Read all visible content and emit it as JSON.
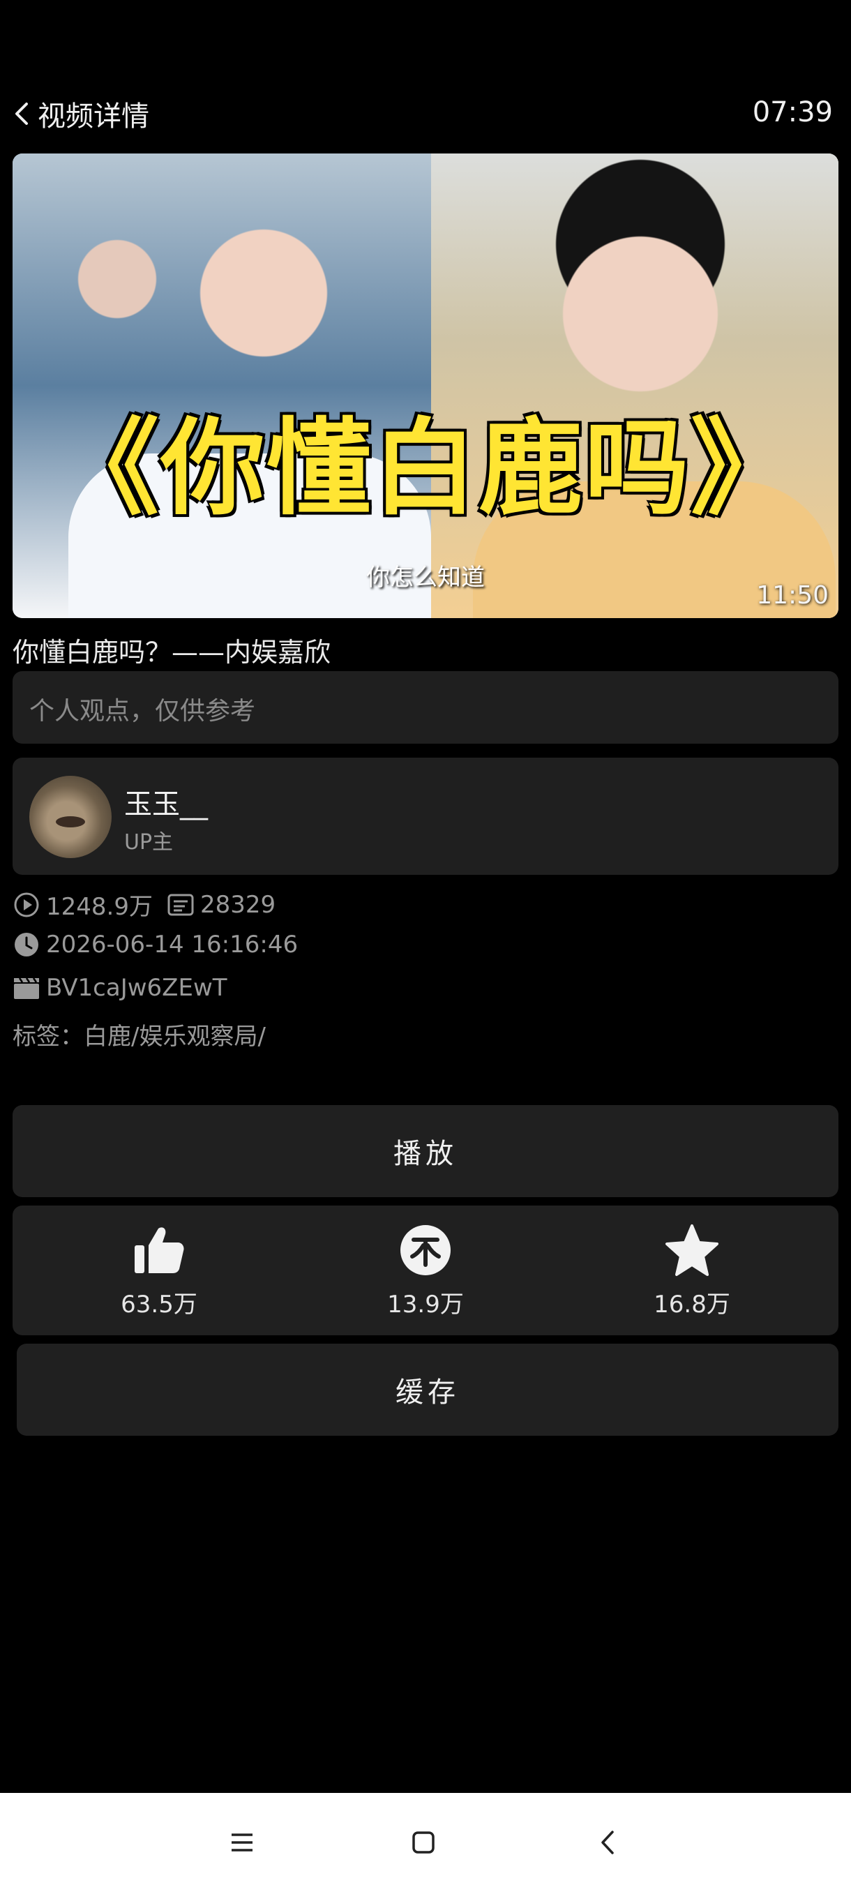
{
  "header": {
    "title": "视频详情",
    "time": "07:39"
  },
  "video": {
    "thumbnail_title": "《你懂白鹿吗》",
    "thumbnail_caption": "你怎么知道",
    "duration": "11:50",
    "title": "你懂白鹿吗？——内娱嘉欣",
    "description_placeholder": "个人观点，仅供参考"
  },
  "author": {
    "name": "玉玉__",
    "role": "UP主"
  },
  "meta": {
    "plays": "1248.9万",
    "danmaku": "28329",
    "datetime": "2026-06-14 16:16:46",
    "bvid": "BV1caJw6ZEwT",
    "tags": "标签：白鹿/娱乐观察局/"
  },
  "buttons": {
    "play": "播放",
    "cache": "缓存"
  },
  "actions": {
    "like": "63.5万",
    "coin": "13.9万",
    "favorite": "16.8万"
  },
  "icons": [
    "back-chevron-icon",
    "play-circle-icon",
    "danmaku-icon",
    "clock-icon",
    "clapperboard-icon",
    "thumbs-up-icon",
    "coin-icon",
    "star-icon",
    "menu-icon",
    "home-icon",
    "back-icon"
  ]
}
